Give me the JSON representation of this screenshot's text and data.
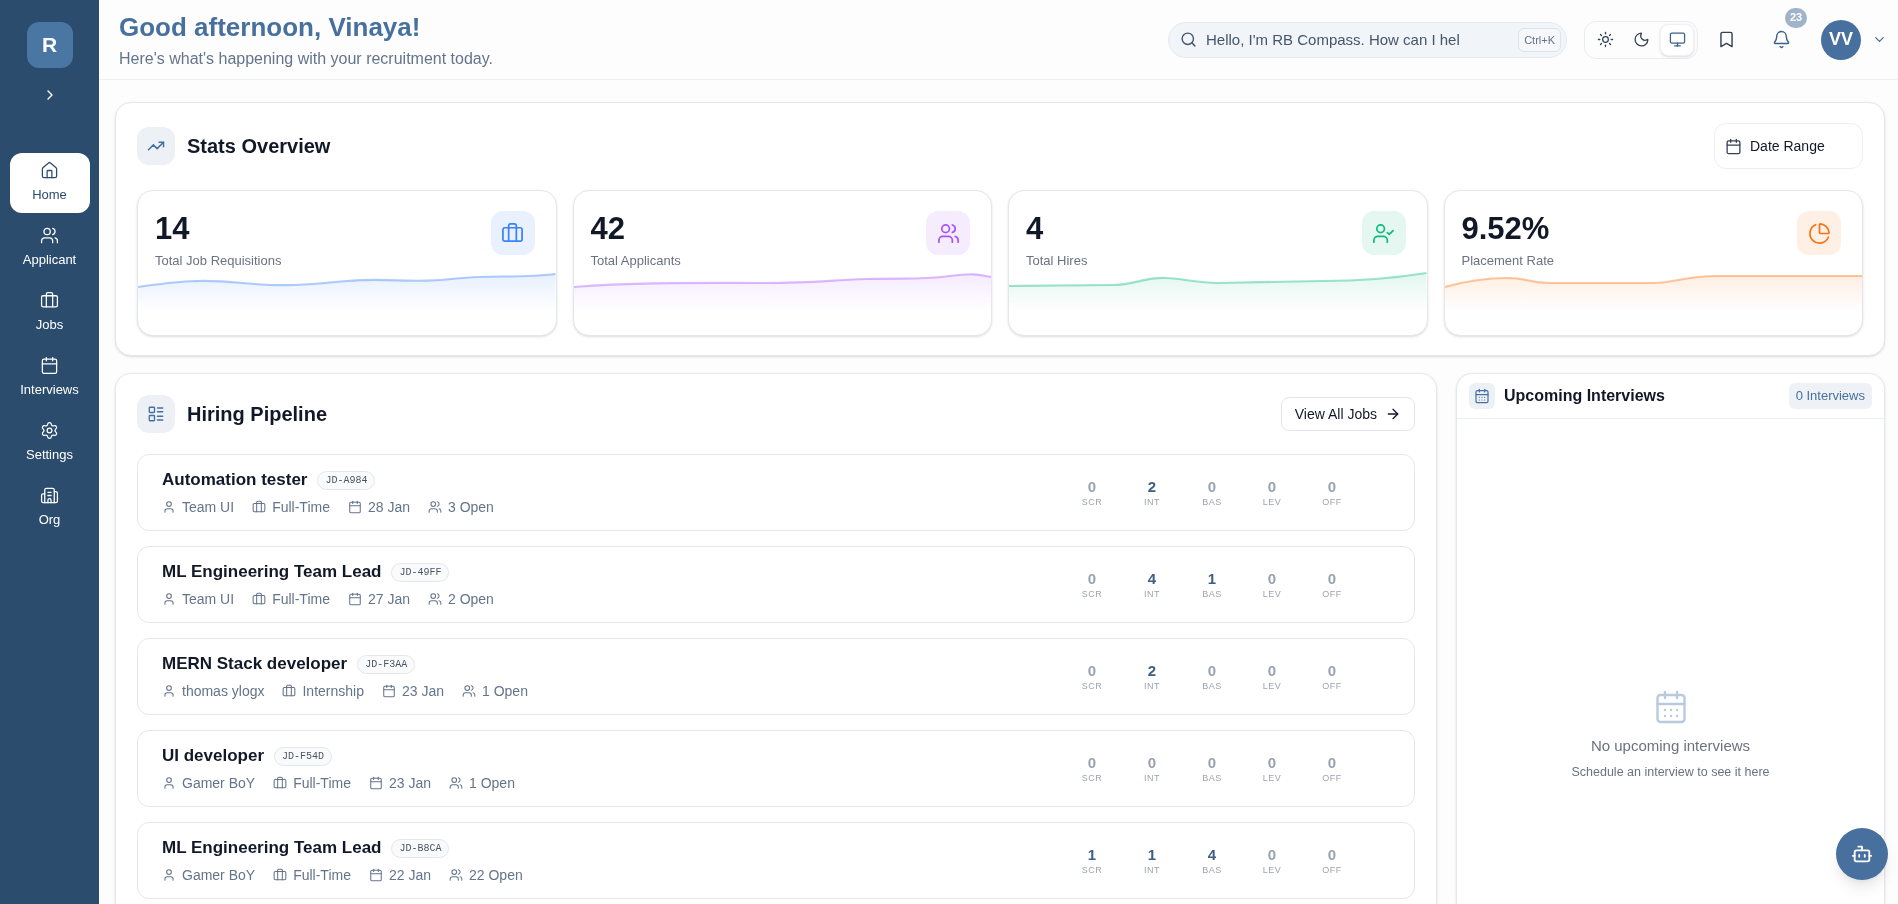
{
  "sidebar": {
    "logo": "R",
    "items": [
      {
        "label": "Home",
        "selected": true
      },
      {
        "label": "Applicant",
        "selected": false
      },
      {
        "label": "Jobs",
        "selected": false
      },
      {
        "label": "Interviews",
        "selected": false
      },
      {
        "label": "Settings",
        "selected": false
      },
      {
        "label": "Org",
        "selected": false
      }
    ]
  },
  "header": {
    "title": "Good afternoon, Vinaya!",
    "subtitle": "Here's what's happening with your recruitment today.",
    "search": {
      "placeholder": "Hello, I'm RB Compass. How can I hel",
      "shortcut": "Ctrl+K"
    },
    "theme_options": [
      {
        "selected": false
      },
      {
        "selected": false
      },
      {
        "selected": true
      }
    ],
    "notifications": "23",
    "avatar": "VV"
  },
  "stats_overview": {
    "title": "Stats Overview",
    "date_range": "Date Range",
    "stats": [
      {
        "value": "14",
        "label": "Total Job Requisitions",
        "color": "#3b82f6"
      },
      {
        "value": "42",
        "label": "Total Applicants",
        "color": "#a855f7"
      },
      {
        "value": "4",
        "label": "Total Hires",
        "color": "#10b981"
      },
      {
        "value": "9.52%",
        "label": "Placement Rate",
        "color": "#f97316"
      }
    ]
  },
  "hiring_pipeline": {
    "title": "Hiring Pipeline",
    "view_all": "View All Jobs",
    "jobs": [
      {
        "title": "Automation tester",
        "code": "JD-A984",
        "owner": "Team UI",
        "type": "Full-Time",
        "date": "28 Jan",
        "openings": "3 Open",
        "stages": [
          {
            "value": "0",
            "label": "SCR",
            "active": false
          },
          {
            "value": "2",
            "label": "INT",
            "active": true
          },
          {
            "value": "0",
            "label": "BAS",
            "active": false
          },
          {
            "value": "0",
            "label": "LEV",
            "active": false
          },
          {
            "value": "0",
            "label": "OFF",
            "active": false
          }
        ]
      },
      {
        "title": "ML Engineering Team Lead",
        "code": "JD-49FF",
        "owner": "Team UI",
        "type": "Full-Time",
        "date": "27 Jan",
        "openings": "2 Open",
        "stages": [
          {
            "value": "0",
            "label": "SCR",
            "active": false
          },
          {
            "value": "4",
            "label": "INT",
            "active": true
          },
          {
            "value": "1",
            "label": "BAS",
            "active": true
          },
          {
            "value": "0",
            "label": "LEV",
            "active": false
          },
          {
            "value": "0",
            "label": "OFF",
            "active": false
          }
        ]
      },
      {
        "title": "MERN Stack developer",
        "code": "JD-F3AA",
        "owner": "thomas ylogx",
        "type": "Internship",
        "date": "23 Jan",
        "openings": "1 Open",
        "stages": [
          {
            "value": "0",
            "label": "SCR",
            "active": false
          },
          {
            "value": "2",
            "label": "INT",
            "active": true
          },
          {
            "value": "0",
            "label": "BAS",
            "active": false
          },
          {
            "value": "0",
            "label": "LEV",
            "active": false
          },
          {
            "value": "0",
            "label": "OFF",
            "active": false
          }
        ]
      },
      {
        "title": "UI developer",
        "code": "JD-F54D",
        "owner": "Gamer BoY",
        "type": "Full-Time",
        "date": "23 Jan",
        "openings": "1 Open",
        "stages": [
          {
            "value": "0",
            "label": "SCR",
            "active": false
          },
          {
            "value": "0",
            "label": "INT",
            "active": false
          },
          {
            "value": "0",
            "label": "BAS",
            "active": false
          },
          {
            "value": "0",
            "label": "LEV",
            "active": false
          },
          {
            "value": "0",
            "label": "OFF",
            "active": false
          }
        ]
      },
      {
        "title": "ML Engineering Team Lead",
        "code": "JD-B8CA",
        "owner": "Gamer BoY",
        "type": "Full-Time",
        "date": "22 Jan",
        "openings": "22 Open",
        "stages": [
          {
            "value": "1",
            "label": "SCR",
            "active": true
          },
          {
            "value": "1",
            "label": "INT",
            "active": true
          },
          {
            "value": "4",
            "label": "BAS",
            "active": true
          },
          {
            "value": "0",
            "label": "LEV",
            "active": false
          },
          {
            "value": "0",
            "label": "OFF",
            "active": false
          }
        ]
      }
    ]
  },
  "upcoming_interviews": {
    "title": "Upcoming Interviews",
    "count": "0 Interviews",
    "empty_title": "No upcoming interviews",
    "empty_text": "Schedule an interview to see it here"
  }
}
